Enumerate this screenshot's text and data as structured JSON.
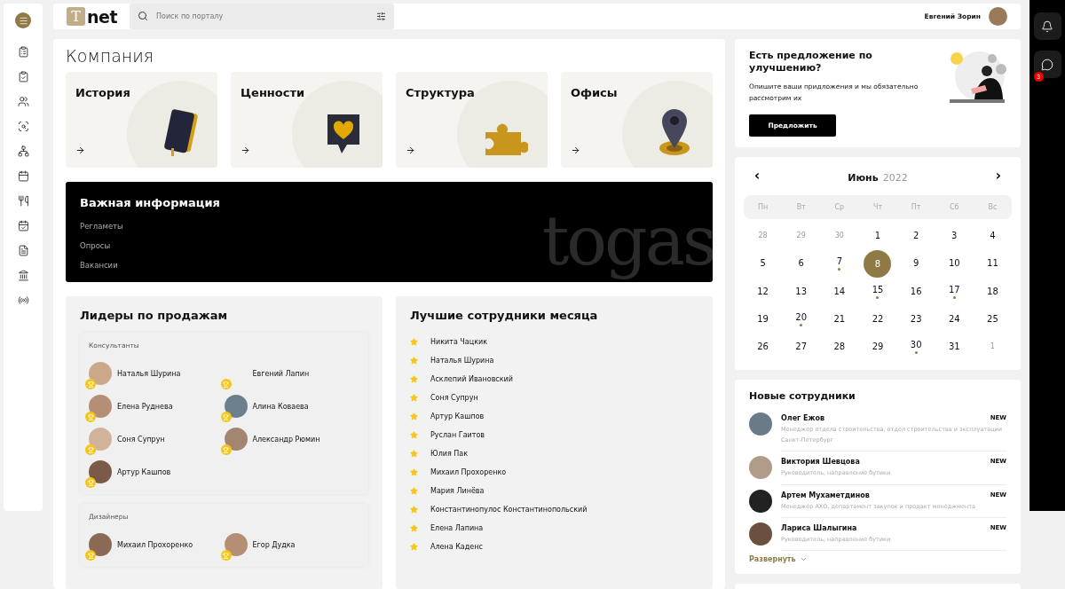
{
  "sidebar": {
    "items": [
      {
        "kind": "menu",
        "selected": true
      },
      {
        "kind": "clipboard",
        "selected": false
      },
      {
        "kind": "clipboard-check",
        "selected": false
      },
      {
        "kind": "users",
        "selected": false
      },
      {
        "kind": "search-doc",
        "selected": false
      },
      {
        "kind": "structure",
        "selected": false
      },
      {
        "kind": "calendar",
        "selected": false
      },
      {
        "kind": "food",
        "selected": false
      },
      {
        "kind": "calendar-check",
        "selected": false
      },
      {
        "kind": "document",
        "selected": false
      },
      {
        "kind": "education",
        "selected": false
      },
      {
        "kind": "broadcast",
        "selected": false
      }
    ]
  },
  "header": {
    "logo": {
      "mark": "T",
      "text": "net"
    },
    "search": {
      "placeholder": "Поиск по порталу"
    },
    "user": {
      "name": "Евгений Зорин"
    }
  },
  "company": {
    "title": "Компания",
    "cards": [
      {
        "title": "История",
        "kind": "book"
      },
      {
        "title": "Ценности",
        "kind": "heart"
      },
      {
        "title": "Структура",
        "kind": "puzzle"
      },
      {
        "title": "Офисы",
        "kind": "pin"
      }
    ]
  },
  "important": {
    "title": "Важная информация",
    "links": [
      "Регламеты",
      "Опросы",
      "Вакансии"
    ],
    "watermark": "togas"
  },
  "leaders": {
    "title": "Лидеры по продажам",
    "groups": [
      {
        "title": "Консультанты",
        "people": [
          {
            "name": "Наталья Шурина",
            "photo": true
          },
          {
            "name": "Евгений Лапин",
            "photo": false
          },
          {
            "name": "Елена Руднева",
            "photo": true
          },
          {
            "name": "Алина Коваева",
            "photo": true
          },
          {
            "name": "Соня Супрун",
            "photo": true
          },
          {
            "name": "Александр Рюмин",
            "photo": true
          },
          {
            "name": "Артур Кашпов",
            "photo": true
          }
        ]
      },
      {
        "title": "Дизайнеры",
        "people": [
          {
            "name": "Михаил Прохоренко",
            "photo": true
          },
          {
            "name": "Егор Дудка",
            "photo": true
          }
        ]
      }
    ]
  },
  "best": {
    "title": "Лучшие сотрудники месяца",
    "people": [
      "Никита Чацкик",
      "Наталья Шурина",
      "Асклепий Ивановский",
      "Соня Супрун",
      "Артур Кашпов",
      "Руслан Гаитов",
      "Юлия Пак",
      "Михаил Прохоренко",
      "Мария Линёва",
      "Константинопулос Константинопольский",
      "Елена Лапина",
      "Алена Каденс"
    ]
  },
  "suggestion": {
    "title": "Есть предложение по улучшению?",
    "text": "Опишите ваши придложения и мы обязательно рассмотрим их",
    "button": "Предложить"
  },
  "calendar": {
    "prev": "‹",
    "next": "›",
    "month": "Июнь",
    "year": "2022",
    "weekdays": [
      "Пн",
      "Вт",
      "Ср",
      "Чт",
      "Пт",
      "Сб",
      "Вс"
    ],
    "days": [
      {
        "label": "28",
        "muted": true,
        "selected": false,
        "event": false
      },
      {
        "label": "29",
        "muted": true,
        "selected": false,
        "event": false
      },
      {
        "label": "30",
        "muted": true,
        "selected": false,
        "event": false
      },
      {
        "label": "1",
        "muted": false,
        "selected": false,
        "event": false
      },
      {
        "label": "2",
        "muted": false,
        "selected": false,
        "event": false
      },
      {
        "label": "3",
        "muted": false,
        "selected": false,
        "event": false
      },
      {
        "label": "4",
        "muted": false,
        "selected": false,
        "event": false
      },
      {
        "label": "5",
        "muted": false,
        "selected": false,
        "event": false
      },
      {
        "label": "6",
        "muted": false,
        "selected": false,
        "event": false
      },
      {
        "label": "7",
        "muted": false,
        "selected": false,
        "event": true
      },
      {
        "label": "8",
        "muted": false,
        "selected": true,
        "event": false
      },
      {
        "label": "9",
        "muted": false,
        "selected": false,
        "event": false
      },
      {
        "label": "10",
        "muted": false,
        "selected": false,
        "event": false
      },
      {
        "label": "11",
        "muted": false,
        "selected": false,
        "event": false
      },
      {
        "label": "12",
        "muted": false,
        "selected": false,
        "event": false
      },
      {
        "label": "13",
        "muted": false,
        "selected": false,
        "event": false
      },
      {
        "label": "14",
        "muted": false,
        "selected": false,
        "event": false
      },
      {
        "label": "15",
        "muted": false,
        "selected": false,
        "event": true
      },
      {
        "label": "16",
        "muted": false,
        "selected": false,
        "event": false
      },
      {
        "label": "17",
        "muted": false,
        "selected": false,
        "event": true
      },
      {
        "label": "18",
        "muted": false,
        "selected": false,
        "event": false
      },
      {
        "label": "19",
        "muted": false,
        "selected": false,
        "event": false
      },
      {
        "label": "20",
        "muted": false,
        "selected": false,
        "event": true
      },
      {
        "label": "21",
        "muted": false,
        "selected": false,
        "event": false
      },
      {
        "label": "22",
        "muted": false,
        "selected": false,
        "event": false
      },
      {
        "label": "23",
        "muted": false,
        "selected": false,
        "event": false
      },
      {
        "label": "24",
        "muted": false,
        "selected": false,
        "event": false
      },
      {
        "label": "25",
        "muted": false,
        "selected": false,
        "event": false
      },
      {
        "label": "26",
        "muted": false,
        "selected": false,
        "event": false
      },
      {
        "label": "27",
        "muted": false,
        "selected": false,
        "event": false
      },
      {
        "label": "28",
        "muted": false,
        "selected": false,
        "event": false
      },
      {
        "label": "29",
        "muted": false,
        "selected": false,
        "event": false
      },
      {
        "label": "30",
        "muted": false,
        "selected": false,
        "event": true
      },
      {
        "label": "31",
        "muted": false,
        "selected": false,
        "event": false
      },
      {
        "label": "1",
        "muted": true,
        "selected": false,
        "event": false
      }
    ]
  },
  "new_employees": {
    "title": "Новые сотрудники",
    "people": [
      {
        "name": "Олег Ежов",
        "role": "Менеджер отдела строительства, отдел строительства и эксплуатации Санкт-Петербург",
        "badge": "NEW"
      },
      {
        "name": "Виктория Шевцова",
        "role": "Руководитель, направление бутики",
        "badge": "NEW"
      },
      {
        "name": "Артем Мухаметдинов",
        "role": "Менеджер АХО, департамент закупок и продакт менеджмента",
        "badge": "NEW"
      },
      {
        "name": "Лариса Шалыгина",
        "role": "Руководитель, направление бутики",
        "badge": "NEW"
      }
    ],
    "expand": "Развернуть"
  },
  "right_rail": {
    "items": [
      {
        "kind": "bell"
      },
      {
        "kind": "chat",
        "badge": "3"
      }
    ]
  }
}
